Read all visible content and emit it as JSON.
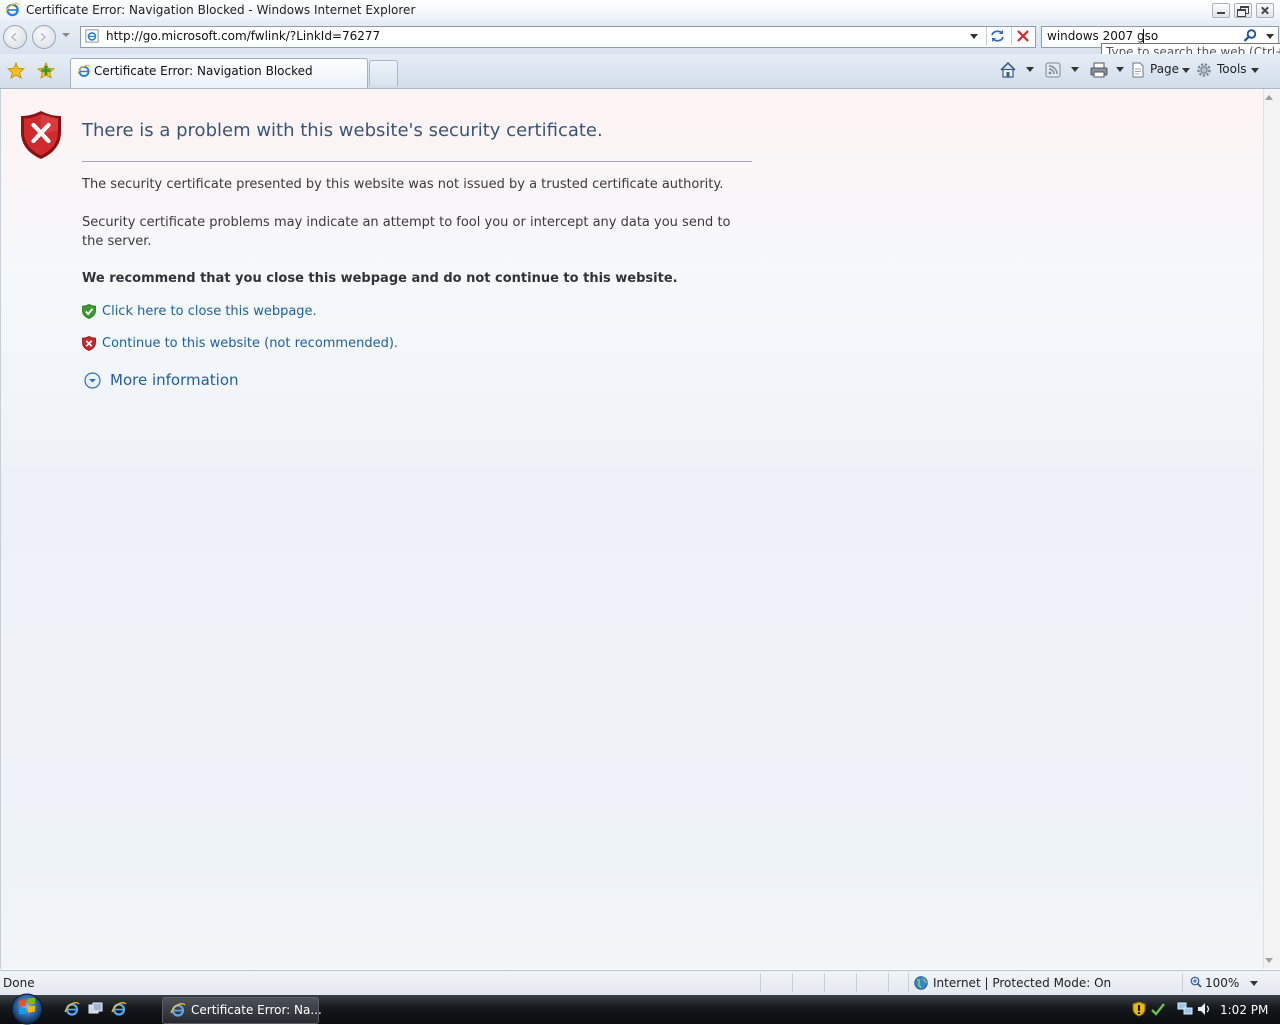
{
  "window": {
    "title": "Certificate Error: Navigation Blocked - Windows Internet Explorer"
  },
  "address_bar": {
    "url": "http://go.microsoft.com/fwlink/?LinkId=76277"
  },
  "search": {
    "value": "windows 2007 gso",
    "tooltip": "Type to search the web (Ctrl+E)"
  },
  "tabs": [
    {
      "label": "Certificate Error: Navigation Blocked",
      "active": true
    }
  ],
  "command_bar": {
    "page_label": "Page",
    "tools_label": "Tools"
  },
  "page": {
    "headline": "There is a problem with this website's security certificate.",
    "paragraph1": "The security certificate presented by this website was not issued by a trusted certificate authority.",
    "paragraph2": "Security certificate problems may indicate an attempt to fool you or intercept any data you send to the server.",
    "recommendation": "We recommend that you close this webpage and do not continue to this website.",
    "close_link": "Click here to close this webpage.",
    "continue_link": "Continue to this website (not recommended).",
    "more_info": "More information"
  },
  "status_bar": {
    "status": "Done",
    "zone": "Internet | Protected Mode: On",
    "zoom": "100%"
  },
  "taskbar": {
    "task_label": "Certificate Error: Na...",
    "clock": "1:02 PM"
  },
  "colors": {
    "link": "#1f5f9c",
    "headline": "#3a5478",
    "error_red": "#c8282b",
    "safe_green": "#3a9b2f"
  }
}
